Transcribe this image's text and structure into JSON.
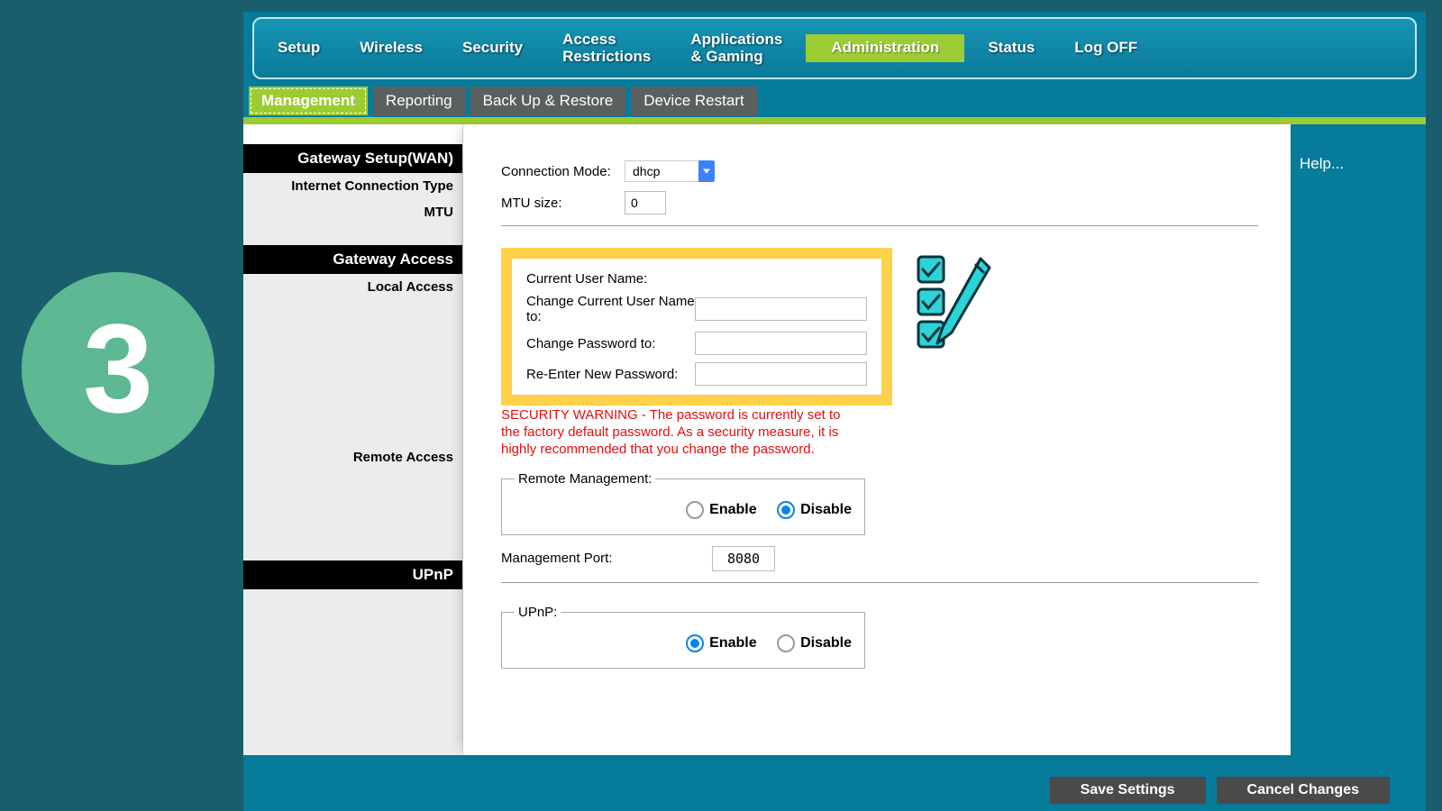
{
  "step_badge": "3",
  "topnav": {
    "items": [
      {
        "label": "Setup"
      },
      {
        "label": "Wireless"
      },
      {
        "label": "Security"
      },
      {
        "label": "Access\nRestrictions"
      },
      {
        "label": "Applications\n& Gaming"
      },
      {
        "label": "Administration",
        "active": true
      },
      {
        "label": "Status"
      },
      {
        "label": "Log OFF"
      }
    ]
  },
  "subnav": {
    "items": [
      {
        "label": "Management",
        "active": true
      },
      {
        "label": "Reporting"
      },
      {
        "label": "Back Up & Restore"
      },
      {
        "label": "Device Restart"
      }
    ]
  },
  "sidebar": {
    "gateway_setup_hdr": "Gateway Setup(WAN)",
    "internet_type_lbl": "Internet Connection Type",
    "mtu_lbl": "MTU",
    "gateway_access_hdr": "Gateway Access",
    "local_access_lbl": "Local Access",
    "remote_access_lbl": "Remote Access",
    "upnp_hdr": "UPnP"
  },
  "form": {
    "conn_mode_lbl": "Connection Mode:",
    "conn_mode_val": "dhcp",
    "mtu_size_lbl": "MTU size:",
    "mtu_size_val": "0",
    "cur_user_lbl": "Current User Name:",
    "chg_user_lbl": "Change Current User Name to:",
    "chg_pass_lbl": "Change Password to:",
    "re_pass_lbl": "Re-Enter New Password:",
    "security_warning": "SECURITY WARNING - The password is currently set to the factory default password. As a security measure, it is highly recommended that you change the password.",
    "remote_legend": "Remote Management:",
    "enable_lbl": "Enable",
    "disable_lbl": "Disable",
    "remote_selected": "disable",
    "mgmt_port_lbl": "Management Port:",
    "mgmt_port_val": "8080",
    "upnp_legend": "UPnP:",
    "upnp_selected": "enable"
  },
  "help": {
    "label": "Help..."
  },
  "buttons": {
    "save": "Save Settings",
    "cancel": "Cancel Changes"
  }
}
